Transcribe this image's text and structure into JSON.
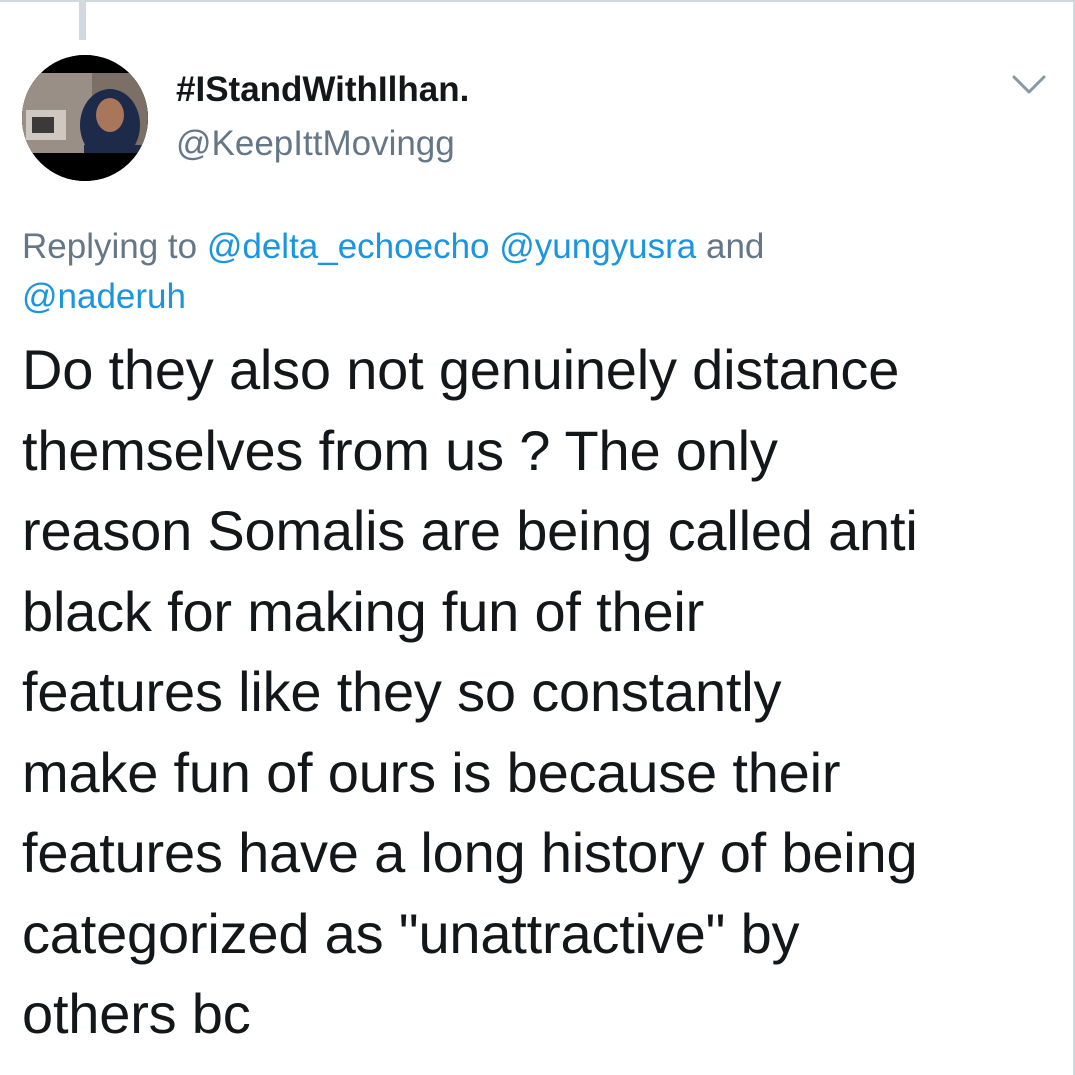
{
  "author": {
    "display_name": "#IStandWithIlhan.",
    "handle": "@KeepIttMovingg",
    "avatar_icon": "user-avatar-photo"
  },
  "menu_icon": "chevron-down-icon",
  "reply": {
    "prefix": "Replying to ",
    "mentions": [
      "@delta_echoecho",
      "@yungyusra",
      "@naderuh"
    ],
    "conjunction": " and "
  },
  "tweet": {
    "lines": [
      "Do they also not genuinely distance",
      "themselves from us ? The only",
      "reason Somalis are being called anti",
      "black for making fun of their",
      "features like they so constantly",
      "make fun of ours is because their",
      "features have a long history of being",
      "categorized as \"unattractive\" by",
      "others bc"
    ]
  },
  "colors": {
    "text": "#14171a",
    "secondary": "#657786",
    "link": "#1b95e0",
    "divider": "#cfd9de"
  }
}
